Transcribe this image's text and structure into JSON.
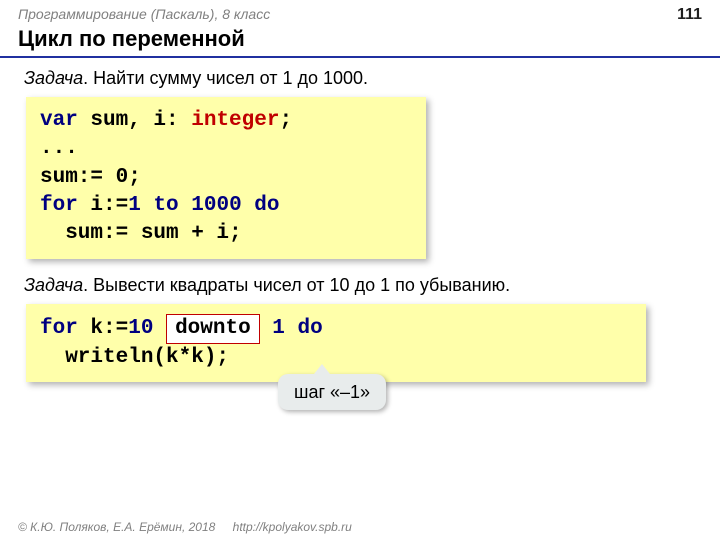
{
  "header": {
    "breadcrumb": "Программирование (Паскаль), 8 класс",
    "page": "111"
  },
  "title": "Цикл по переменной",
  "task1": {
    "label": "Задача",
    "text": ". Найти сумму чисел от 1 до 1000."
  },
  "code1": {
    "l1_a": "var",
    "l1_b": " sum, i: ",
    "l1_c": "integer",
    "l1_d": ";",
    "l2": "...",
    "l3": "sum:= 0;",
    "l4_a": "for",
    "l4_b": " i:=",
    "l4_c": "1",
    "l4_d": " to ",
    "l4_e": "1000",
    "l4_f": " do",
    "l5": "  sum:= sum + i;"
  },
  "task2": {
    "label": "Задача",
    "text": ". Вывести квадраты чисел от 10 до 1 по убыванию."
  },
  "code2": {
    "l1_a": "for",
    "l1_b": " k:=",
    "l1_c": "10",
    "l1_d": " ",
    "l1_box": "downto",
    "l1_e": " ",
    "l1_f": "1",
    "l1_g": " do",
    "l2": "  writeln(k*k);"
  },
  "callout": "шаг «–1»",
  "footer": {
    "copyright": "© К.Ю. Поляков, Е.А. Ерёмин, 2018",
    "url": "http://kpolyakov.spb.ru"
  }
}
